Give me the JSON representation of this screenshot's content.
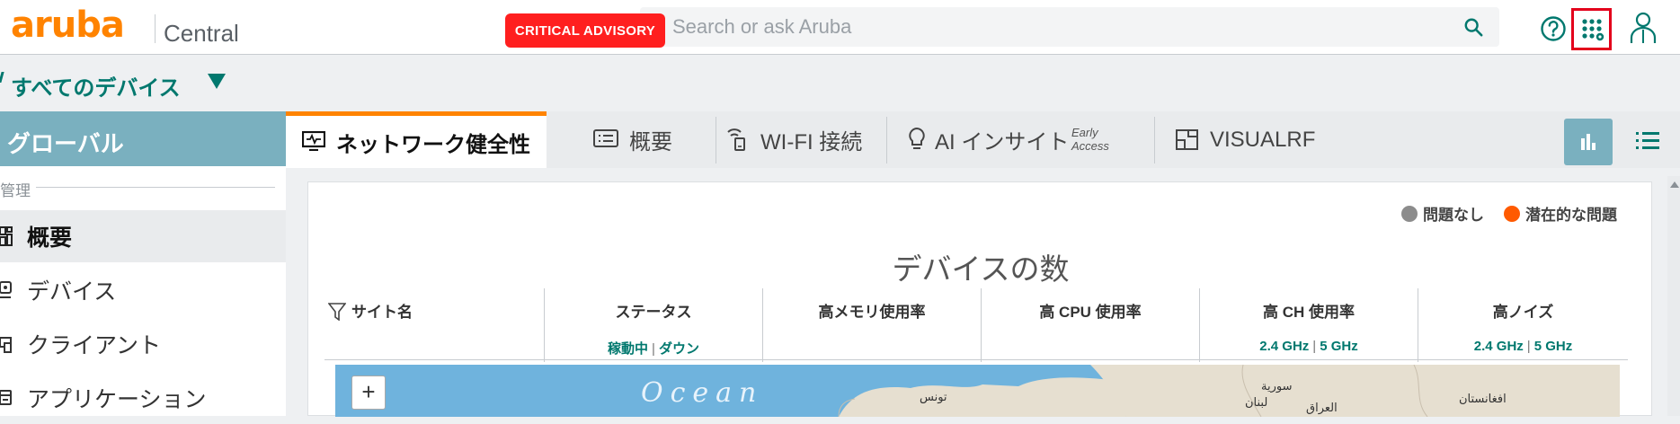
{
  "header": {
    "logo_text": "aruba",
    "brand": "Central",
    "advisory_label": "CRITICAL ADVISORY",
    "search_placeholder": "Search or ask Aruba",
    "icons": [
      "search-icon",
      "help-icon",
      "apps-icon",
      "user-icon"
    ]
  },
  "filter": {
    "label": "すべてのデバイス"
  },
  "sidebar": {
    "scope": "グローバル",
    "section": "管理",
    "items": [
      {
        "label": "概要",
        "icon": "dashboard-icon",
        "active": true
      },
      {
        "label": "デバイス",
        "icon": "device-icon",
        "active": false
      },
      {
        "label": "クライアント",
        "icon": "client-icon",
        "active": false
      },
      {
        "label": "アプリケーション",
        "icon": "application-icon",
        "active": false
      }
    ]
  },
  "tabs": [
    {
      "label": "ネットワーク健全性",
      "icon": "monitor-icon",
      "active": true
    },
    {
      "label": "概要",
      "icon": "list-icon",
      "active": false
    },
    {
      "label": "WI-FI 接続",
      "icon": "wifi-device-icon",
      "active": false
    },
    {
      "label": "AI インサイト",
      "badge": "Early Access",
      "icon": "lightbulb-icon",
      "active": false
    },
    {
      "label": "VISUALRF",
      "icon": "floorplan-icon",
      "active": false
    }
  ],
  "panel": {
    "legend": [
      {
        "label": "問題なし",
        "color": "#8c8c8c"
      },
      {
        "label": "潜在的な問題",
        "color": "#ff5a00"
      }
    ],
    "title": "デバイスの数",
    "columns": [
      {
        "header": "サイト名",
        "sub": []
      },
      {
        "header": "ステータス",
        "sub": [
          "稼動中",
          "ダウン"
        ]
      },
      {
        "header": "高メモリ使用率",
        "sub": []
      },
      {
        "header": "高 CPU 使用率",
        "sub": []
      },
      {
        "header": "高 CH 使用率",
        "sub": [
          "2.4 GHz",
          "5 GHz"
        ]
      },
      {
        "header": "高ノイズ",
        "sub": [
          "2.4 GHz",
          "5 GHz"
        ]
      }
    ],
    "map": {
      "zoom_in": "+",
      "ocean_label": "Ocean",
      "place_labels": [
        "تونس",
        "سورية",
        "لبنان",
        "العراق",
        "افغانستان"
      ]
    }
  },
  "colors": {
    "accent": "#ff8300",
    "teal": "#00786e",
    "scope": "#7ab0bf",
    "advisory": "#ff1f1f"
  }
}
